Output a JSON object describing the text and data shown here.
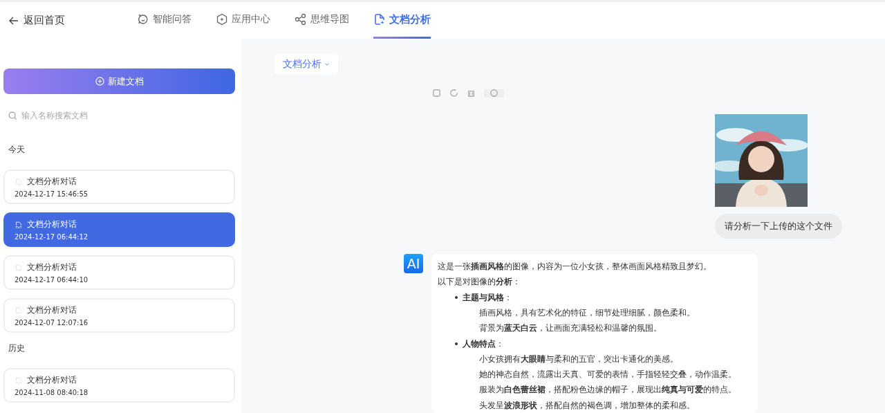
{
  "header": {
    "back": "返回首页",
    "tabs": [
      {
        "label": "智能问答",
        "kind": "chat",
        "selected": false
      },
      {
        "label": "应用中心",
        "kind": "hexagon",
        "selected": false
      },
      {
        "label": "思维导图",
        "kind": "nodes",
        "selected": false
      },
      {
        "label": "文档分析",
        "kind": "doc",
        "selected": true
      }
    ]
  },
  "sidebar": {
    "new_button": "新建文档",
    "search": {
      "placeholder": "输入名称搜索文档"
    },
    "groups": [
      {
        "title": "今天",
        "items": [
          {
            "title": "文档分析对话",
            "time": "2024-12-17 15:46:55",
            "selected": false
          },
          {
            "title": "文档分析对话",
            "time": "2024-12-17 06:44:12",
            "selected": true
          },
          {
            "title": "文档分析对话",
            "time": "2024-12-17 06:44:10",
            "selected": false
          },
          {
            "title": "文档分析对话",
            "time": "2024-12-07 12:07:16",
            "selected": false
          }
        ]
      },
      {
        "title": "历史",
        "items": [
          {
            "title": "文档分析对话",
            "time": "2024-11-08 08:40:18",
            "selected": false
          }
        ]
      }
    ]
  },
  "main": {
    "mode_dropdown": "文档分析",
    "user_message": {
      "text": "请分析一下上传的这个文件"
    },
    "ai_message": {
      "avatar": "AI",
      "lines": [
        {
          "kind": "para",
          "text": "这是一张**插画风格**的图像，内容为一位小女孩，整体画面风格精致且梦幻。"
        },
        {
          "kind": "para",
          "text": "以下是对图像的**分析**："
        },
        {
          "kind": "bullet",
          "text": "**主题与风格**："
        },
        {
          "kind": "sub",
          "text": "插画风格，具有艺术化的特征，细节处理细腻，颜色柔和。"
        },
        {
          "kind": "sub",
          "text": "背景为**蓝天白云**，让画面充满轻松和温馨的氛围。"
        },
        {
          "kind": "bullet",
          "text": "**人物特点**："
        },
        {
          "kind": "sub",
          "text": "小女孩拥有**大眼睛**与柔和的五官，突出卡通化的美感。"
        },
        {
          "kind": "sub",
          "text": "她的神态自然，流露出天真、可爱的表情，手指轻轻交叠，动作温柔。"
        },
        {
          "kind": "sub",
          "text": "服装为**白色蕾丝裙**，搭配粉色边缘的帽子，展现出**纯真与可爱**的特点。"
        },
        {
          "kind": "sub",
          "text": "头发呈**波浪形状**，搭配自然的褐色调，增加整体的柔和感。"
        }
      ]
    }
  }
}
